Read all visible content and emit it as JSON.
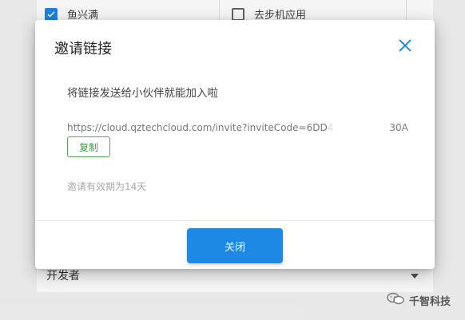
{
  "background": {
    "checkbox_1_label": "鱼兴满",
    "checkbox_2_label": "去步机应用",
    "select_value": "开发者"
  },
  "dialog": {
    "title": "邀请链接",
    "message": "将链接发送给小伙伴就能加入啦",
    "link": "https://cloud.qztechcloud.com/invite?inviteCode=6DD4",
    "link_tail": "30A",
    "copy_label": "复制",
    "validity": "邀请有效期为14天",
    "close_label": "关闭"
  },
  "watermark": {
    "text": "千智科技"
  },
  "colors": {
    "primary": "#1e88e5",
    "copy_green": "#3f9a44"
  },
  "icons": {
    "close": "close-icon",
    "checkbox": "checkbox-icon",
    "dropdown": "chevron-down-icon",
    "watermark": "wechat-icon"
  }
}
